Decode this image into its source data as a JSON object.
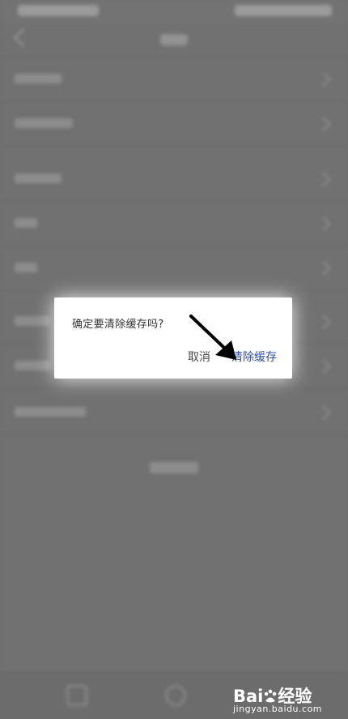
{
  "dialog": {
    "message": "确定要清除缓存吗?",
    "cancel_label": "取消",
    "confirm_label": "清除缓存",
    "confirm_color": "#2d4fb4"
  },
  "watermark": {
    "brand_left": "Bai",
    "brand_right": "经验",
    "url": "jingyan.baidu.com"
  },
  "annotation": {
    "icon": "arrow-pointer-icon",
    "color": "#000000"
  }
}
